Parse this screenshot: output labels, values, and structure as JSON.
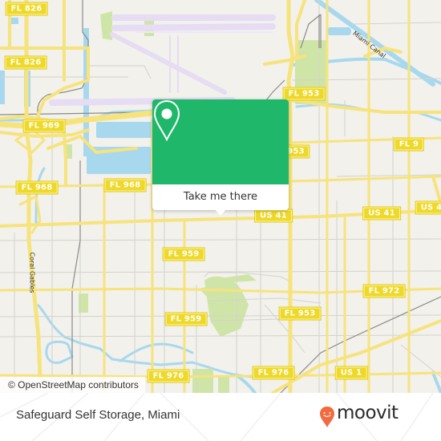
{
  "map": {
    "colors": {
      "land": "#f2f1ec",
      "highway": "#f7e37c",
      "water": "#a8d8ee",
      "park": "#cfe5a8",
      "runway": "#e6dcf3",
      "minor_road": "#cfcfcf",
      "rail": "#888888"
    },
    "road_shields": [
      {
        "id": "fl826-top",
        "label": "FL 826"
      },
      {
        "id": "fl826-mid",
        "label": "FL 826"
      },
      {
        "id": "fl969",
        "label": "FL 969"
      },
      {
        "id": "fl968-left",
        "label": "FL 968"
      },
      {
        "id": "fl968-right",
        "label": "FL 968"
      },
      {
        "id": "fl953-top",
        "label": "FL 953"
      },
      {
        "id": "fl953-mid",
        "label": "953"
      },
      {
        "id": "fl9",
        "label": "FL 9"
      },
      {
        "id": "us41-mid",
        "label": "US 41"
      },
      {
        "id": "us41-right",
        "label": "US 41"
      },
      {
        "id": "us41-edge",
        "label": "US 4"
      },
      {
        "id": "fl959-top",
        "label": "FL 959"
      },
      {
        "id": "fl959-bottom",
        "label": "FL 959"
      },
      {
        "id": "fl972",
        "label": "FL 972"
      },
      {
        "id": "fl953-bottom",
        "label": "FL 953"
      },
      {
        "id": "fl976-left",
        "label": "FL 976"
      },
      {
        "id": "fl976-right",
        "label": "FL 976"
      },
      {
        "id": "us1",
        "label": "US 1"
      }
    ],
    "canal_labels": {
      "miami_canal": "Miami Canal",
      "coral_gables": "Coral Gables"
    },
    "attribution": "© OpenStreetMap contributors"
  },
  "popup": {
    "icon": "map-pin-icon",
    "cta_label": "Take me there",
    "accent_color": "#1fb86a"
  },
  "footer": {
    "place_name": "Safeguard Self Storage, Miami",
    "brand": "moovit",
    "brand_color": "#f26a3d"
  }
}
